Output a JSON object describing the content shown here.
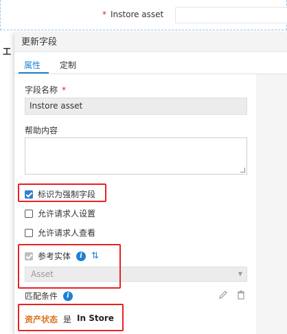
{
  "background_form": {
    "required_mark": "*",
    "field_label": "Instore asset",
    "left_text": "工"
  },
  "panel": {
    "title": "更新字段",
    "tabs": [
      {
        "label": "属性",
        "active": true
      },
      {
        "label": "定制",
        "active": false
      }
    ],
    "field_name": {
      "label": "字段名称",
      "required_mark": "*",
      "value": "Instore asset"
    },
    "help": {
      "label": "帮助内容",
      "value": ""
    },
    "checkboxes": [
      {
        "label": "标识为强制字段",
        "checked": true
      },
      {
        "label": "允许请求人设置",
        "checked": false
      },
      {
        "label": "允许请求人查看",
        "checked": false
      }
    ],
    "reference_entity": {
      "label": "参考实体",
      "checked": true,
      "disabled": true,
      "info_icon": "i",
      "sort_icon": "⇅",
      "selected": "Asset"
    },
    "match_condition": {
      "label": "匹配条件",
      "info_icon": "i",
      "field": "资产状态",
      "operator": "是",
      "value": "In Store"
    }
  },
  "colors": {
    "accent": "#1f80d4",
    "highlight": "#e82020",
    "condition_field": "#d9731f"
  }
}
